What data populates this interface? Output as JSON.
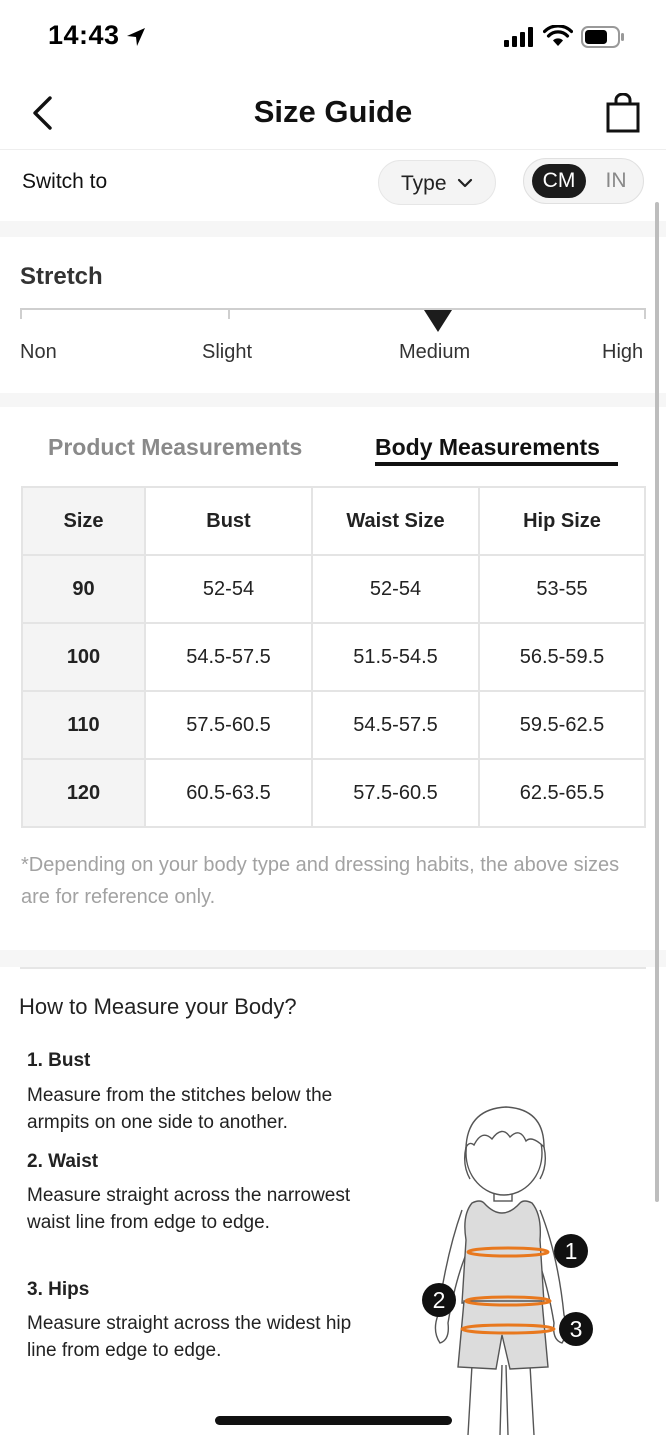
{
  "status_bar": {
    "time": "14:43",
    "icons": [
      "location-arrow-icon",
      "signal-icon",
      "wifi-icon",
      "battery-icon"
    ]
  },
  "header": {
    "title": "Size Guide",
    "back_icon": "chevron-left-icon",
    "bag_icon": "shopping-bag-icon"
  },
  "switch": {
    "label": "Switch to",
    "type_label": "Type",
    "units": [
      "CM",
      "IN"
    ],
    "selected_unit": "CM"
  },
  "stretch": {
    "title": "Stretch",
    "levels": [
      "Non",
      "Slight",
      "Medium",
      "High"
    ],
    "selected": "Medium"
  },
  "tabs": {
    "items": [
      "Product Measurements",
      "Body Measurements"
    ],
    "active": "Body Measurements"
  },
  "table": {
    "headers": [
      "Size",
      "Bust",
      "Waist Size",
      "Hip Size"
    ],
    "rows": [
      [
        "90",
        "52-54",
        "52-54",
        "53-55"
      ],
      [
        "100",
        "54.5-57.5",
        "51.5-54.5",
        "56.5-59.5"
      ],
      [
        "110",
        "57.5-60.5",
        "54.5-57.5",
        "59.5-62.5"
      ],
      [
        "120",
        "60.5-63.5",
        "57.5-60.5",
        "62.5-65.5"
      ]
    ]
  },
  "note": "*Depending on your body type and dressing habits, the above sizes are for reference only.",
  "how_to": {
    "title": "How to Measure your Body?",
    "steps": [
      {
        "title": "1. Bust",
        "desc": "Measure from the stitches below the armpits on one side to another."
      },
      {
        "title": "2. Waist",
        "desc": "Measure straight across the narrowest waist line from edge to edge."
      },
      {
        "title": "3. Hips",
        "desc": "Measure straight across the widest hip line from edge to edge."
      }
    ],
    "markers": [
      "1",
      "2",
      "3"
    ]
  },
  "colors": {
    "accent_orange": "#e8781e",
    "dark": "#1c1c1c",
    "muted": "#a2a2a2"
  }
}
